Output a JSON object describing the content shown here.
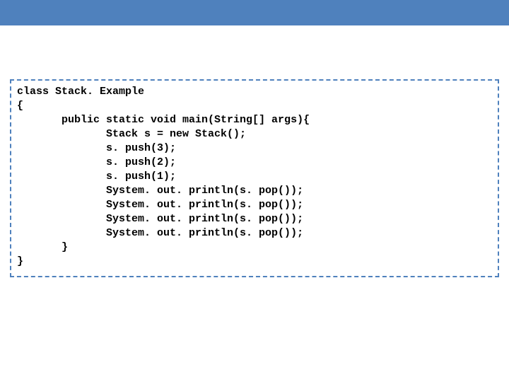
{
  "code": {
    "lines": [
      "class Stack. Example",
      "{",
      "       public static void main(String[] args){",
      "              Stack s = new Stack();",
      "              s. push(3);",
      "              s. push(2);",
      "              s. push(1);",
      "              System. out. println(s. pop());",
      "              System. out. println(s. pop());",
      "              System. out. println(s. pop());",
      "              System. out. println(s. pop());",
      "       }",
      "}"
    ]
  },
  "colors": {
    "accent": "#4f81bd"
  }
}
